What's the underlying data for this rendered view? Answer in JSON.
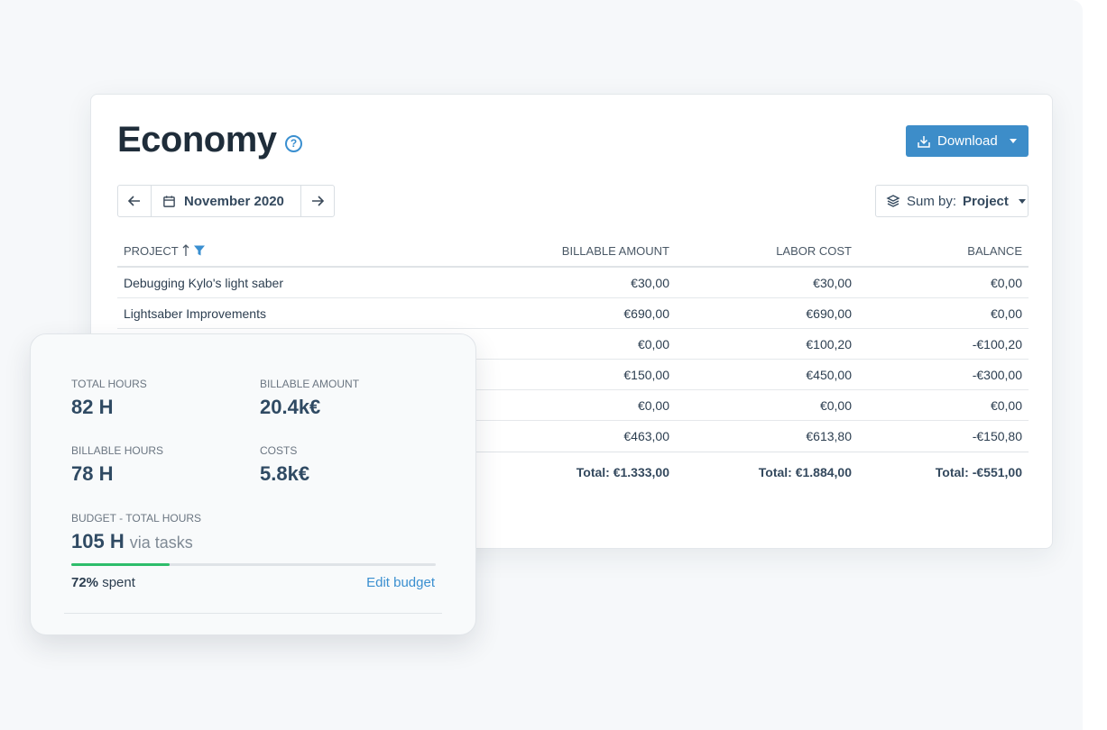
{
  "economy": {
    "title": "Economy",
    "help_icon": "question-circle-icon",
    "download_label": "Download",
    "date_nav": {
      "month": "November 2020"
    },
    "sum_by": {
      "prefix": "Sum by:",
      "value": "Project"
    },
    "table": {
      "headers": {
        "project": "PROJECT",
        "billable": "BILLABLE AMOUNT",
        "labor": "LABOR COST",
        "balance": "BALANCE"
      },
      "rows": [
        {
          "project": "Debugging Kylo's light saber",
          "billable": "€30,00",
          "labor": "€30,00",
          "balance": "€0,00"
        },
        {
          "project": "Lightsaber Improvements",
          "billable": "€690,00",
          "labor": "€690,00",
          "balance": "€0,00"
        },
        {
          "project": "",
          "billable": "€0,00",
          "labor": "€100,20",
          "balance": "-€100,20"
        },
        {
          "project": "",
          "billable": "€150,00",
          "labor": "€450,00",
          "balance": "-€300,00"
        },
        {
          "project": "",
          "billable": "€0,00",
          "labor": "€0,00",
          "balance": "€0,00"
        },
        {
          "project": "",
          "billable": "€463,00",
          "labor": "€613,80",
          "balance": "-€150,80"
        }
      ],
      "totals": {
        "billable": "Total: €1.333,00",
        "labor": "Total: €1.884,00",
        "balance": "Total: -€551,00"
      }
    }
  },
  "stats": {
    "total_hours": {
      "label": "TOTAL HOURS",
      "value": "82 H"
    },
    "billable_amount": {
      "label": "BILLABLE AMOUNT",
      "value": "20.4k€"
    },
    "billable_hours": {
      "label": "BILLABLE HOURS",
      "value": "78 H"
    },
    "costs": {
      "label": "COSTS",
      "value": "5.8k€"
    },
    "budget": {
      "label": "BUDGET - TOTAL HOURS",
      "value": "105 H",
      "via": "via tasks"
    },
    "spent": {
      "percent_label": "72%",
      "suffix": "spent",
      "fraction": 0.27
    },
    "edit_budget_label": "Edit budget"
  },
  "colors": {
    "accent": "#3d8dc9",
    "progress": "#2ebd6b",
    "heading": "#1f2d3a"
  }
}
